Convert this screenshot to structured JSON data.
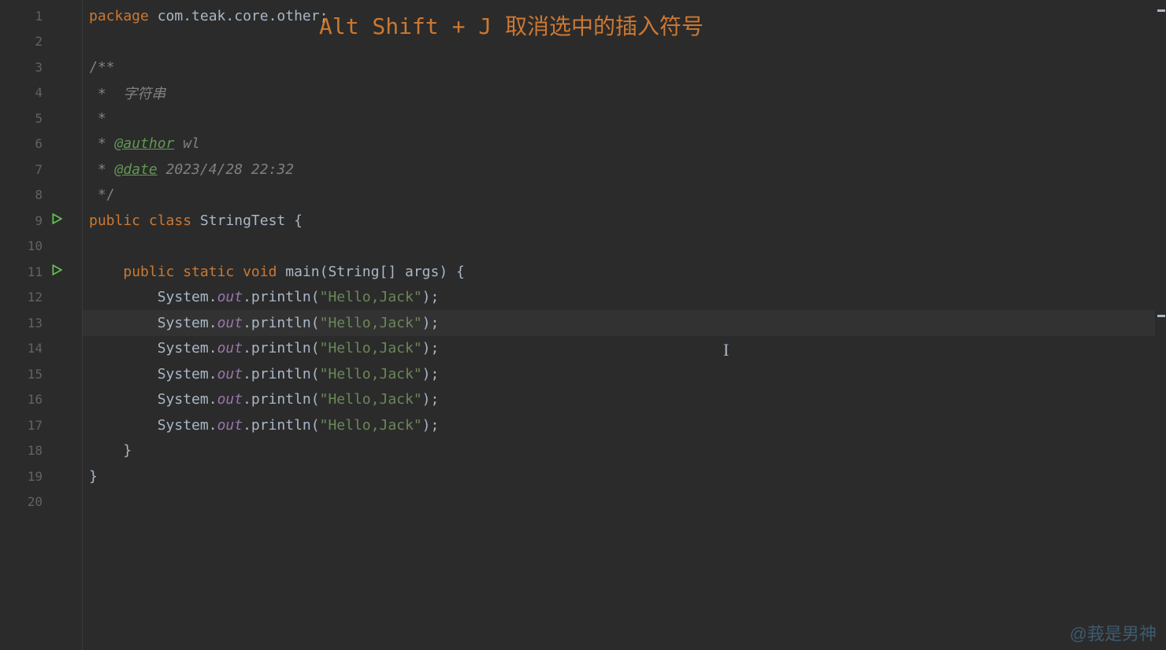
{
  "overlay": "Alt Shift + J 取消选中的插入符号",
  "watermark": "@莪是男神",
  "lines": [
    {
      "num": "1",
      "run": false
    },
    {
      "num": "2",
      "run": false
    },
    {
      "num": "3",
      "run": false
    },
    {
      "num": "4",
      "run": false
    },
    {
      "num": "5",
      "run": false
    },
    {
      "num": "6",
      "run": false
    },
    {
      "num": "7",
      "run": false
    },
    {
      "num": "8",
      "run": false
    },
    {
      "num": "9",
      "run": true
    },
    {
      "num": "10",
      "run": false
    },
    {
      "num": "11",
      "run": true
    },
    {
      "num": "12",
      "run": false
    },
    {
      "num": "13",
      "run": false
    },
    {
      "num": "14",
      "run": false
    },
    {
      "num": "15",
      "run": false
    },
    {
      "num": "16",
      "run": false
    },
    {
      "num": "17",
      "run": false
    },
    {
      "num": "18",
      "run": false
    },
    {
      "num": "19",
      "run": false
    },
    {
      "num": "20",
      "run": false
    }
  ],
  "code": {
    "pkg_kw": "package ",
    "pkg_val": "com.teak.core.other",
    "semicolon": ";",
    "doc_open": "/**",
    "doc_l1": " *  字符串",
    "doc_l2": " *",
    "doc_l3_pre": " * ",
    "doc_author_tag": "@author",
    "doc_author_val": " wl",
    "doc_l4_pre": " * ",
    "doc_date_tag": "@date",
    "doc_date_val": " 2023/4/28 22:32",
    "doc_close": " */",
    "cls_public": "public ",
    "cls_class": "class ",
    "cls_name": "StringTest ",
    "brace_open": "{",
    "brace_close": "}",
    "method_indent": "    ",
    "method_public": "public ",
    "method_static": "static ",
    "method_void": "void ",
    "method_name": "main",
    "method_params": "(String[] args) ",
    "body_indent": "        ",
    "sys": "System.",
    "out": "out",
    "println": ".println(",
    "hello": "\"Hello,Jack\"",
    "close_paren": ")",
    "method_close_indent": "    "
  },
  "highlighted_line": 13
}
